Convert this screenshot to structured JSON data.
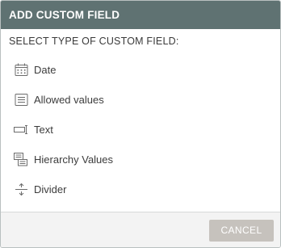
{
  "dialog": {
    "title": "ADD CUSTOM FIELD",
    "subtitle": "SELECT TYPE OF CUSTOM FIELD:"
  },
  "field_types": [
    {
      "label": "Date",
      "icon": "calendar-icon"
    },
    {
      "label": "Allowed values",
      "icon": "list-icon"
    },
    {
      "label": "Text",
      "icon": "text-field-icon"
    },
    {
      "label": "Hierarchy Values",
      "icon": "hierarchy-icon"
    },
    {
      "label": "Divider",
      "icon": "divider-icon"
    }
  ],
  "footer": {
    "cancel_label": "CANCEL"
  },
  "colors": {
    "header_bg": "#5f7272",
    "cancel_bg": "#c6c2bd",
    "footer_bg": "#f3f3f3",
    "icon": "#6b6b6b"
  }
}
